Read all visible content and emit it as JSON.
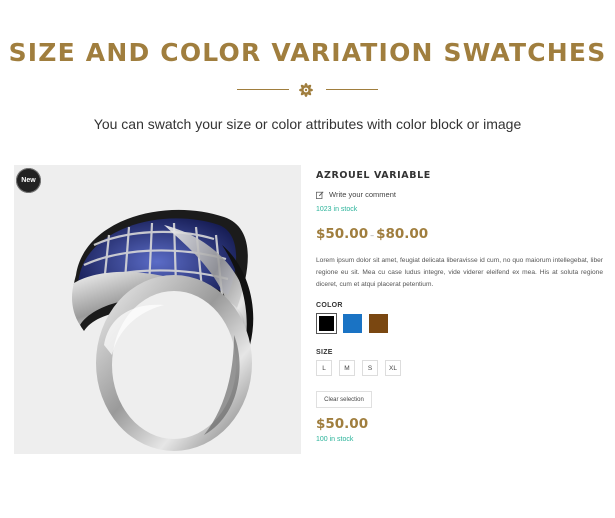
{
  "header": {
    "title": "SIZE AND COLOR VARIATION SWATCHES",
    "subtitle": "You can swatch your size or color attributes with color block or image"
  },
  "product": {
    "badge": "New",
    "name": "AZROUEL VARIABLE",
    "review_link": "Write your comment",
    "stock_top": "1023 in stock",
    "price_min": "$50.00",
    "price_separator": "–",
    "price_max": "$80.00",
    "description": "Lorem ipsum dolor sit amet, feugiat delicata liberavisse id cum, no quo maiorum intellegebat, liber regione eu sit. Mea cu case ludus integre, vide viderer eleifend ex mea. His at soluta regione diceret, cum et atqui placerat petentium.",
    "color_label": "COLOR",
    "colors": [
      {
        "name": "black",
        "hex": "#000000",
        "selected": true
      },
      {
        "name": "blue",
        "hex": "#1a73c4",
        "selected": false
      },
      {
        "name": "brown",
        "hex": "#7a4711",
        "selected": false
      }
    ],
    "size_label": "SIZE",
    "sizes": [
      "L",
      "M",
      "S",
      "XL"
    ],
    "clear_label": "Clear selection",
    "price_final": "$50.00",
    "stock_bottom": "100 in stock"
  },
  "theme": {
    "accent": "#a07e3e",
    "stock_color": "#2ab39a"
  }
}
